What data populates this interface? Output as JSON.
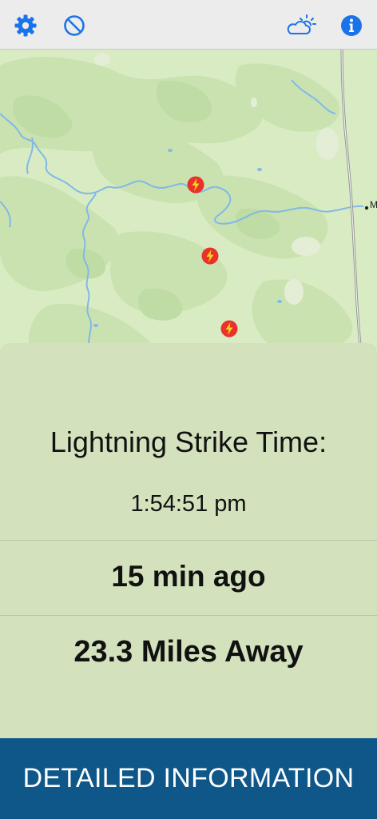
{
  "toolbar": {
    "left_icons": [
      "gear-icon",
      "block-icon"
    ],
    "right_icons": [
      "partly-cloudy-icon",
      "info-icon"
    ],
    "accent_color": "#1a73e8"
  },
  "map": {
    "place_label": "M",
    "strike_icon": "lightning-bolt-icon",
    "strike_count": 3
  },
  "panel": {
    "title": "Lightning Strike Time:",
    "time": "1:54:51 pm",
    "ago": "15 min ago",
    "distance": "23.3 Miles Away"
  },
  "detail_button": {
    "label": "DETAILED INFORMATION",
    "color": "#0f5789"
  }
}
